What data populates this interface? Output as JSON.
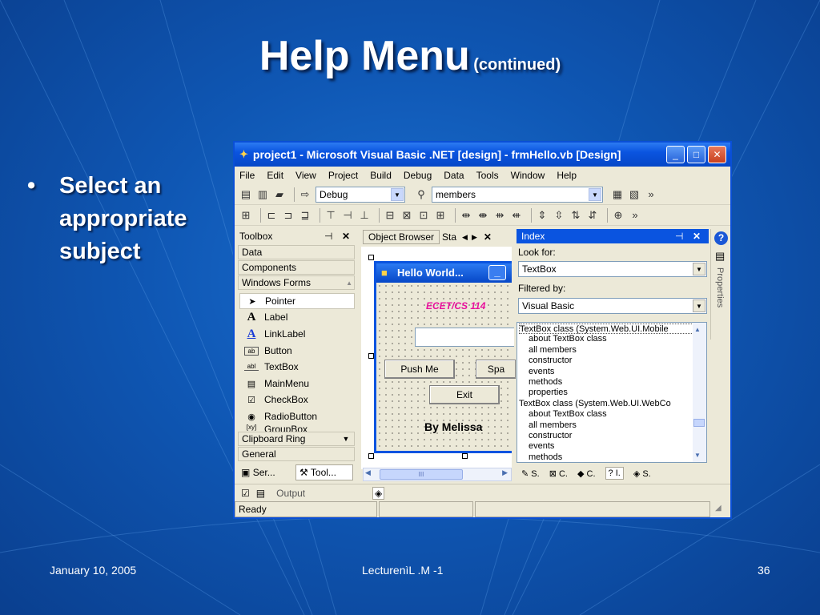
{
  "slide": {
    "title": "Help Menu",
    "title_suffix": "(continued)",
    "bullet": "Select an appropriate subject",
    "footer_date": "January 10, 2005",
    "footer_center": "LecturenìL .M -1",
    "page_number": "36"
  },
  "window": {
    "title": "project1 - Microsoft Visual Basic .NET [design] - frmHello.vb [Design]",
    "menu": [
      "File",
      "Edit",
      "View",
      "Project",
      "Build",
      "Debug",
      "Data",
      "Tools",
      "Window",
      "Help"
    ],
    "config_combo": "Debug",
    "find_combo": "members",
    "status": "Ready"
  },
  "toolbox": {
    "title": "Toolbox",
    "categories_top": [
      "Data",
      "Components",
      "Windows Forms"
    ],
    "items": [
      {
        "label": "Pointer",
        "icon": "pointer-icon"
      },
      {
        "label": "Label",
        "icon": "label-icon"
      },
      {
        "label": "LinkLabel",
        "icon": "linklabel-icon"
      },
      {
        "label": "Button",
        "icon": "button-icon"
      },
      {
        "label": "TextBox",
        "icon": "textbox-icon"
      },
      {
        "label": "MainMenu",
        "icon": "mainmenu-icon"
      },
      {
        "label": "CheckBox",
        "icon": "checkbox-icon"
      },
      {
        "label": "RadioButton",
        "icon": "radiobutton-icon"
      },
      {
        "label": "GroupBox",
        "icon": "groupbox-icon"
      }
    ],
    "categories_bottom": [
      "Clipboard Ring",
      "General"
    ],
    "bottom_tabs": [
      "Ser...",
      "Tool..."
    ]
  },
  "designer": {
    "tabs": [
      "Object Browser",
      "Sta"
    ],
    "form_title": "Hello World...",
    "course_label": "ECET/CS 114",
    "push_button": "Push Me",
    "spa_button": "Spa",
    "exit_button": "Exit",
    "author_label": "By Melissa",
    "scroll_label": "III"
  },
  "index": {
    "title": "Index",
    "look_for_label": "Look for:",
    "look_for_value": "TextBox",
    "filter_label": "Filtered by:",
    "filter_value": "Visual Basic",
    "results": [
      {
        "text": "TextBox class (System.Web.UI.Mobile",
        "indent": false
      },
      {
        "text": "about TextBox class",
        "indent": true
      },
      {
        "text": "all members",
        "indent": true
      },
      {
        "text": "constructor",
        "indent": true
      },
      {
        "text": "events",
        "indent": true
      },
      {
        "text": "methods",
        "indent": true
      },
      {
        "text": "properties",
        "indent": true
      },
      {
        "text": "TextBox class (System.Web.UI.WebCo",
        "indent": false
      },
      {
        "text": "about TextBox class",
        "indent": true
      },
      {
        "text": "all members",
        "indent": true
      },
      {
        "text": "constructor",
        "indent": true
      },
      {
        "text": "events",
        "indent": true
      },
      {
        "text": "methods",
        "indent": true
      }
    ],
    "bottom_tabs": [
      "S.",
      "C.",
      "C.",
      "I.",
      "S."
    ],
    "properties_tab": "Properties"
  },
  "output": {
    "label": "Output"
  },
  "colors": {
    "accent": "#0a54e0",
    "slide_bg": "#1461c4",
    "designer_label": "#e8119c"
  }
}
